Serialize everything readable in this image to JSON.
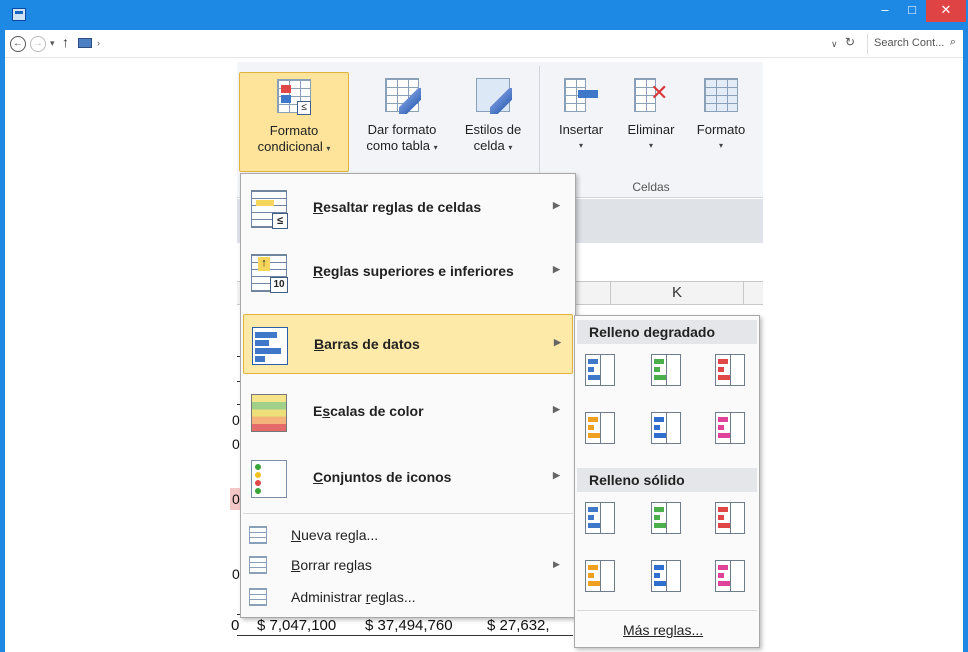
{
  "window": {
    "minimize_glyph": "–",
    "maximize_glyph": "□",
    "close_glyph": "✕"
  },
  "address_bar": {
    "search_placeholder": "Search Cont...",
    "dropdown_glyph": "∨",
    "refresh_glyph": "↻"
  },
  "ribbon": {
    "buttons": [
      {
        "line1": "Formato",
        "line2": "condicional",
        "dropdown": "▾"
      },
      {
        "line1": "Dar formato",
        "line2": "como tabla",
        "dropdown": "▾"
      },
      {
        "line1": "Estilos de",
        "line2": "celda",
        "dropdown": "▾"
      },
      {
        "line1": "Insertar",
        "line2": "",
        "dropdown": "▾"
      },
      {
        "line1": "Eliminar",
        "line2": "",
        "dropdown": "▾"
      },
      {
        "line1": "Formato",
        "line2": "",
        "dropdown": "▾"
      }
    ],
    "group_label": "Celdas"
  },
  "sheet": {
    "column_header": "K",
    "edge_values": [
      "0",
      "0",
      "0",
      "0",
      "0"
    ],
    "totals": [
      "$ 7,047,100",
      "$ 37,494,760",
      "$ 27,632,"
    ],
    "totals_prefix": "0"
  },
  "conditional_menu": {
    "items": [
      {
        "label": "Resaltar reglas de celdas",
        "underline": "R",
        "rest": "esaltar reglas de celdas",
        "has_submenu": true
      },
      {
        "label": "Reglas superiores e inferiores",
        "underline": "R",
        "rest": "eglas superiores e inferiores",
        "has_submenu": true
      },
      {
        "label": "Barras de datos",
        "underline": "B",
        "rest": "arras de datos",
        "has_submenu": true,
        "highlighted": true
      },
      {
        "label": "Escalas de color",
        "underline": "s",
        "pre": "E",
        "rest": "calas de color",
        "has_submenu": true
      },
      {
        "label": "Conjuntos de iconos",
        "underline": "C",
        "rest": "onjuntos de iconos",
        "has_submenu": true
      }
    ],
    "small_items": [
      {
        "label": "Nueva regla...",
        "underline": "N",
        "rest": "ueva regla...",
        "has_submenu": false
      },
      {
        "label": "Borrar reglas",
        "underline": "B",
        "rest": "orrar reglas",
        "has_submenu": true
      },
      {
        "label": "Administrar reglas...",
        "pre": "Administrar ",
        "underline": "r",
        "rest": "eglas...",
        "has_submenu": false
      }
    ],
    "arrow_glyph": "▶"
  },
  "data_bars_submenu": {
    "gradient_header": "Relleno degradado",
    "solid_header": "Relleno sólido",
    "more_rules": "Más reglas...",
    "swatch_colors": [
      "#3f78c8",
      "#4bb04b",
      "#e04848",
      "#f0a020",
      "#2f6fd0",
      "#e0449a"
    ]
  },
  "colors": {
    "title_bar": "#1e88e5",
    "highlight": "#fde9a8",
    "highlight_border": "#e1b23f"
  }
}
